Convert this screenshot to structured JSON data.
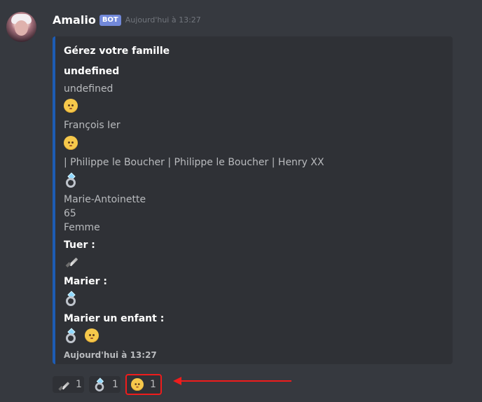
{
  "message": {
    "author": "Amalio",
    "bot_tag": "BOT",
    "timestamp": "Aujourd'hui à 13:27"
  },
  "embed": {
    "title": "Gérez votre famille",
    "field_name": "undefined",
    "field_value": "undefined",
    "person_1": "François Ier",
    "children": "| Philippe le Boucher | Philippe le Boucher | Henry XX",
    "spouse": "Marie-Antoinette",
    "age": "65",
    "gender": "Femme",
    "tuer_label": "Tuer :",
    "marier_label": "Marier :",
    "marier_enfant_label": "Marier un enfant :",
    "footer_timestamp": "Aujourd'hui à 13:27",
    "colors": {
      "accent": "#1d5cb4",
      "background": "#2f3136"
    }
  },
  "reactions": [
    {
      "icon": "dagger-icon",
      "count": "1"
    },
    {
      "icon": "ring-icon",
      "count": "1"
    },
    {
      "icon": "baby-icon",
      "count": "1"
    }
  ],
  "colors": {
    "app_background": "#36393f",
    "annotation_red": "#ef1c1c",
    "bot_tag": "#7289da"
  }
}
